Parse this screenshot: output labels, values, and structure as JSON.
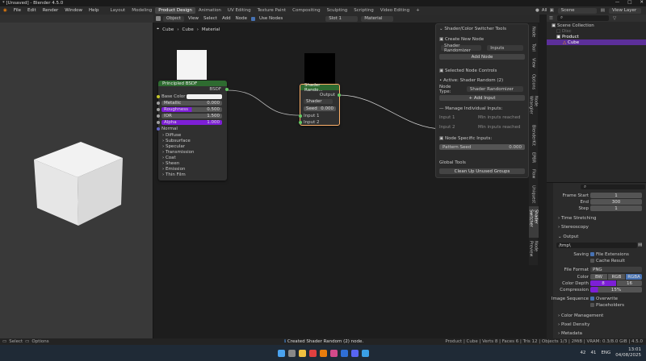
{
  "window": {
    "title": "* [Unsaved] - Blender 4.5.0"
  },
  "menu": {
    "items": [
      "File",
      "Edit",
      "Render",
      "Window",
      "Help"
    ]
  },
  "workspaces": [
    "Layout",
    "Modeling",
    "Product Design",
    "Animation",
    "UV Editing",
    "Texture Paint",
    "Compositing",
    "Sculpting",
    "Scripting",
    "Video Editing"
  ],
  "active_workspace": "Product Design",
  "topright": {
    "scene_label": "Scene",
    "view_layer_label": "View Layer",
    "all_label": "All"
  },
  "node_header": {
    "object_mode": "Object",
    "items": [
      "View",
      "Select",
      "Add",
      "Node"
    ],
    "use_nodes": "Use Nodes",
    "slot": "Slot 1",
    "material": "Material"
  },
  "breadcrumb": {
    "items": [
      "Cube",
      "Cube",
      "Material"
    ]
  },
  "principled": {
    "title": "Principled BSDF",
    "output": "BSDF",
    "base_color_label": "Base Color",
    "inputs": [
      {
        "label": "Metallic",
        "value": "0.000"
      },
      {
        "label": "Roughness",
        "value": "0.500"
      },
      {
        "label": "IOR",
        "value": "1.500"
      },
      {
        "label": "Alpha",
        "value": "1.000"
      }
    ],
    "normal_label": "Normal",
    "sections": [
      "Diffuse",
      "Subsurface",
      "Specular",
      "Transmission",
      "Coat",
      "Sheen",
      "Emission",
      "Thin Film"
    ]
  },
  "shader_random": {
    "title": "Shader Rando...",
    "output": "Output",
    "dropdown": "Shader",
    "seed_label": "Seed",
    "seed_value": "0.000",
    "inputs": [
      "Input 1",
      "Input 2"
    ]
  },
  "npanel": {
    "title": "Shader/Color Switcher Tools",
    "create_section": "Create New Node",
    "create_type": "Shader Randomizer",
    "create_inputs": "Inputs",
    "add_node_btn": "Add Node",
    "selected_section": "Selected Node Controls",
    "active_label": "Active: Shader Random (2)",
    "node_type_label": "Node Type:",
    "node_type_value": "Shader Randomizer",
    "add_input_btn": "Add Input",
    "manage_section": "Manage Individual Inputs:",
    "inputs": [
      {
        "label": "Input 1",
        "status": "Min inputs reached"
      },
      {
        "label": "Input 2",
        "status": "Min inputs reached"
      }
    ],
    "specific_section": "Node Specific Inputs:",
    "pattern_seed_label": "Pattern Seed",
    "pattern_seed_value": "0.000",
    "global_section": "Global Tools",
    "cleanup_btn": "Clean Up Unused Groups"
  },
  "side_tabs": [
    "Node",
    "Tool",
    "View",
    "Options",
    "Node Wrangler",
    "BlenderKit",
    "EPBR",
    "Flow",
    "Uniquest",
    "Shader Switcher",
    "Node Preview"
  ],
  "active_side_tab": "Shader Switcher",
  "outliner": {
    "collection": "Scene Collection",
    "items": [
      {
        "name": "Disc",
        "dim": true
      },
      {
        "name": "Product",
        "dim": false
      },
      {
        "name": "Cube",
        "dim": false,
        "selected": true
      }
    ]
  },
  "properties": {
    "frame_start_label": "Frame Start",
    "frame_start": "1",
    "end_label": "End",
    "end": "300",
    "step_label": "Step",
    "step": "1",
    "time_stretching": "Time Stretching",
    "stereoscopy": "Stereoscopy",
    "output_section": "Output",
    "output_path": "/tmp\\",
    "saving_label": "Saving",
    "file_extensions": "File Extensions",
    "cache_result": "Cache Result",
    "file_format_label": "File Format",
    "file_format": "PNG",
    "color_label": "Color",
    "color_options": [
      "BW",
      "RGB",
      "RGBA"
    ],
    "color_active": "RGBA",
    "color_depth_label": "Color Depth",
    "color_depth_options": [
      "8",
      "16"
    ],
    "color_depth_active": "8",
    "compression_label": "Compression",
    "compression": "15%",
    "image_sequence_label": "Image Sequence",
    "overwrite": "Overwrite",
    "placeholders": "Placeholders",
    "color_management": "Color Management",
    "pixel_density": "Pixel Density",
    "metadata": "Metadata"
  },
  "statusbar": {
    "left_items": [
      "Select",
      "Options"
    ],
    "message": "Created Shader Random (2) node.",
    "stats": "Product | Cube | Verts 8 | Faces 6 | Tris 12 | Objects 1/3 | 2MiB | VRAM: 0.3/8.0 GiB | 4.5.0"
  },
  "taskbar": {
    "lang": "ENG",
    "time": "13:01",
    "date": "04/08/2025",
    "temp": "42",
    "num": "41"
  },
  "colors": {
    "principled_header": "#2e6b30",
    "shader_header": "#2e6b30",
    "selection": "#7a3bd1",
    "purple_field": "#7d1fd6",
    "active_tab": "#3c3c3c"
  }
}
